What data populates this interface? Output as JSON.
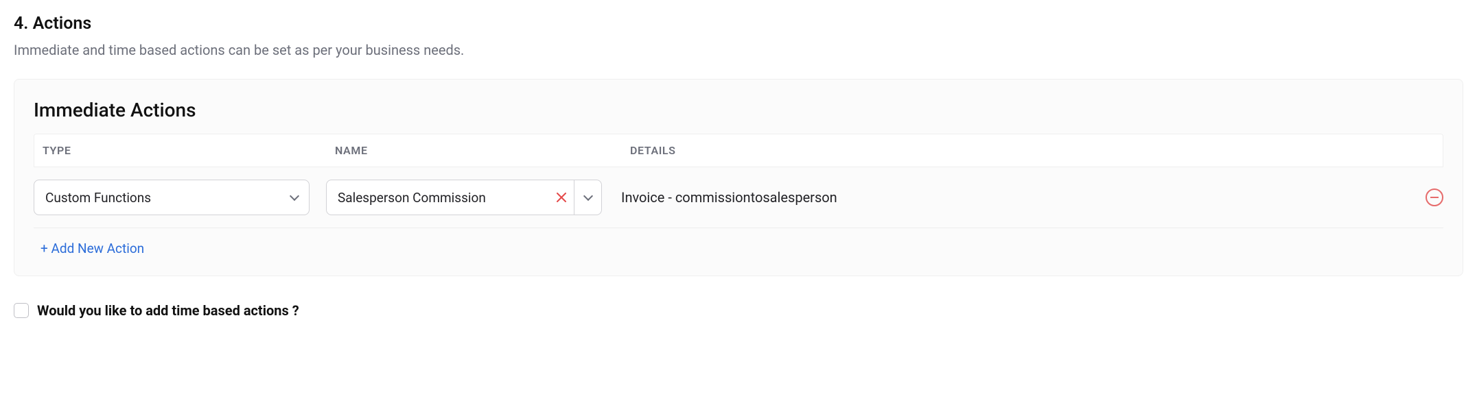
{
  "section": {
    "title": "4. Actions",
    "subtitle": "Immediate and time based actions can be set as per your business needs."
  },
  "panel": {
    "title": "Immediate Actions",
    "headers": {
      "type": "TYPE",
      "name": "NAME",
      "details": "DETAILS"
    },
    "row": {
      "type_value": "Custom Functions",
      "name_value": "Salesperson Commission",
      "details_value": "Invoice - commissiontosalesperson"
    },
    "add_link": "+ Add New Action"
  },
  "timebased": {
    "label": "Would you like to add time based actions ?"
  }
}
